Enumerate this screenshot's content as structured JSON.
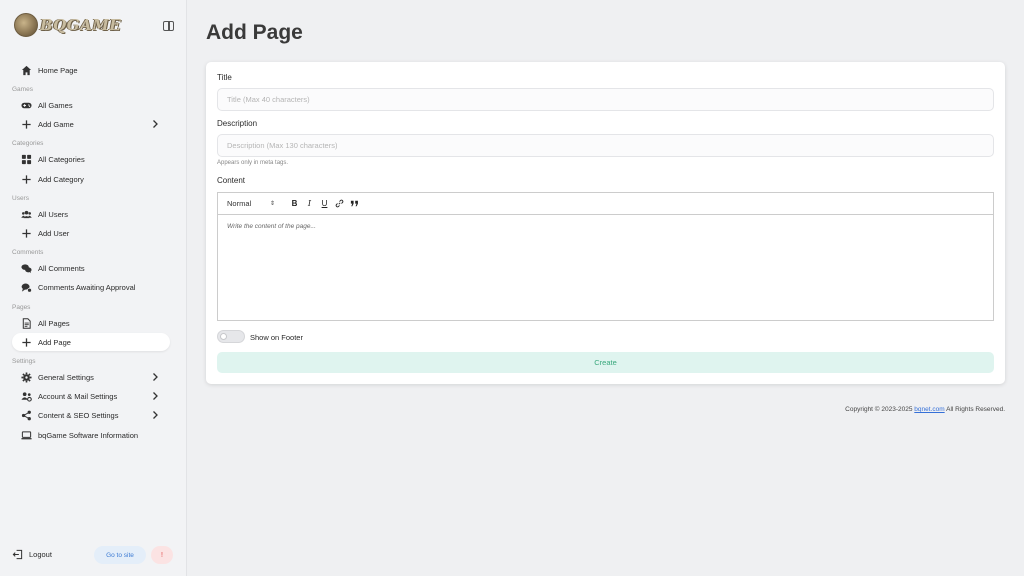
{
  "brand": {
    "name": "BQGAME"
  },
  "nav": {
    "home": "Home Page",
    "games_section": "Games",
    "all_games": "All Games",
    "add_game": "Add Game",
    "categories_section": "Categories",
    "all_categories": "All Categories",
    "add_category": "Add Category",
    "users_section": "Users",
    "all_users": "All Users",
    "add_user": "Add User",
    "comments_section": "Comments",
    "all_comments": "All Comments",
    "comments_awaiting": "Comments Awaiting Approval",
    "pages_section": "Pages",
    "all_pages": "All Pages",
    "add_page": "Add Page",
    "settings_section": "Settings",
    "general_settings": "General Settings",
    "account_mail_settings": "Account & Mail Settings",
    "content_seo_settings": "Content & SEO Settings",
    "software_info": "bqGame Software Information"
  },
  "footer_nav": {
    "logout": "Logout",
    "goto_site": "Go to site",
    "alert": "!"
  },
  "page": {
    "title": "Add Page",
    "title_label": "Title",
    "title_placeholder": "Title (Max 40 characters)",
    "title_value": "",
    "description_label": "Description",
    "description_placeholder": "Description (Max 130 characters)",
    "description_value": "",
    "description_hint": "Appears only in meta tags.",
    "content_label": "Content",
    "editor_format": "Normal",
    "editor_placeholder": "Write the content of the page...",
    "toggle_label": "Show on Footer",
    "toggle_on": false,
    "create_label": "Create"
  },
  "copyright": {
    "prefix": "Copyright © 2023-2025",
    "link": "bqnet.com",
    "suffix": "All Rights Reserved."
  },
  "colors": {
    "accent_blue": "#3d7bd3",
    "create_green": "#3aa87d",
    "alert_red": "#e04848"
  }
}
